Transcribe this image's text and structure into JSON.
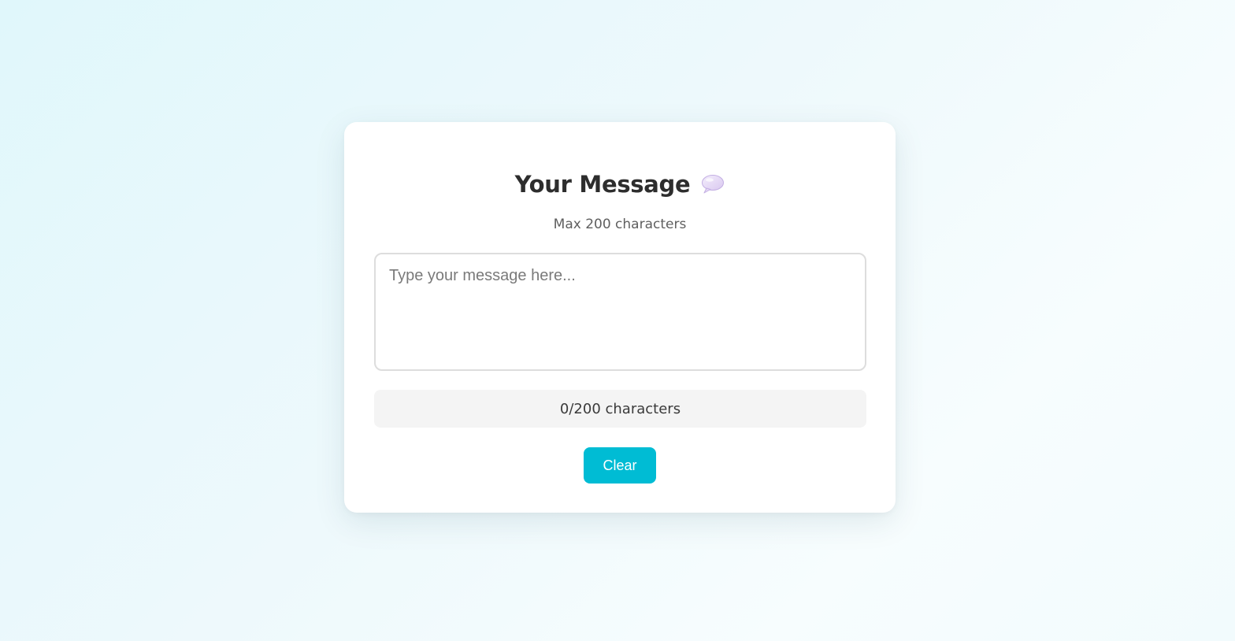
{
  "card": {
    "title": "Your Message",
    "title_icon": "speech-bubble-icon",
    "subtitle": "Max 200 characters"
  },
  "message": {
    "value": "",
    "placeholder": "Type your message here..."
  },
  "counter": {
    "text": "0/200 characters"
  },
  "actions": {
    "clear_label": "Clear"
  },
  "colors": {
    "accent": "#00bcd4",
    "title": "#2d2d2d",
    "counter_bg": "#f4f4f4"
  }
}
